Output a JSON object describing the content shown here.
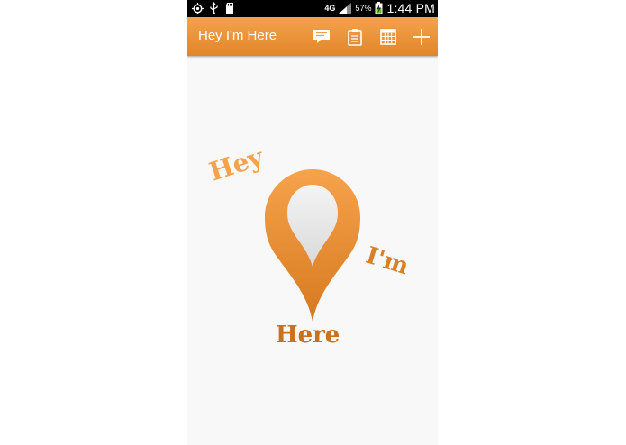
{
  "status_bar": {
    "network": "4G",
    "battery": "57%",
    "time": "1:44 PM"
  },
  "action_bar": {
    "title": "Hey I'm Here",
    "actions": [
      {
        "name": "chat-bubble-icon"
      },
      {
        "name": "clipboard-icon"
      },
      {
        "name": "calendar-icon"
      },
      {
        "name": "add-icon"
      }
    ]
  },
  "logo": {
    "word1": "Hey",
    "word2": "I'm",
    "word3": "Here",
    "colors": {
      "light_orange": "#f4a24c",
      "mid_orange": "#d98024",
      "dark_orange": "#c8711e"
    }
  }
}
